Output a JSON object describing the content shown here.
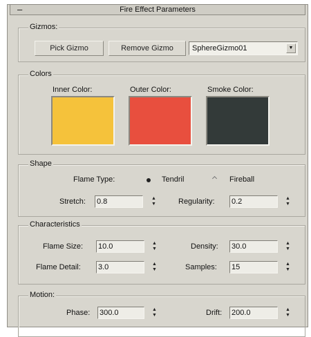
{
  "panel": {
    "title": "Fire Effect Parameters",
    "collapse_glyph": "–"
  },
  "gizmos": {
    "label": "Gizmos:",
    "pick_button": "Pick Gizmo",
    "remove_button": "Remove Gizmo",
    "selected_gizmo": "SphereGizmo01"
  },
  "colors": {
    "label": "Colors",
    "inner": {
      "label": "Inner Color:",
      "hex": "#f5c23b"
    },
    "outer": {
      "label": "Outer Color:",
      "hex": "#e84f3e"
    },
    "smoke": {
      "label": "Smoke Color:",
      "hex": "#333a39"
    }
  },
  "shape": {
    "label": "Shape",
    "flame_type_label": "Flame Type:",
    "tendril_label": "Tendril",
    "fireball_label": "Fireball",
    "selected": "Tendril",
    "stretch_label": "Stretch:",
    "stretch_value": "0.8",
    "regularity_label": "Regularity:",
    "regularity_value": "0.2"
  },
  "characteristics": {
    "label": "Characteristics",
    "flame_size_label": "Flame Size:",
    "flame_size_value": "10.0",
    "density_label": "Density:",
    "density_value": "30.0",
    "flame_detail_label": "Flame Detail:",
    "flame_detail_value": "3.0",
    "samples_label": "Samples:",
    "samples_value": "15"
  },
  "motion": {
    "label": "Motion:",
    "phase_label": "Phase:",
    "phase_value": "300.0",
    "drift_label": "Drift:",
    "drift_value": "200.0"
  },
  "icons": {
    "spinner": "up-down-spinner-icon",
    "dropdown": "chevron-down-icon"
  }
}
